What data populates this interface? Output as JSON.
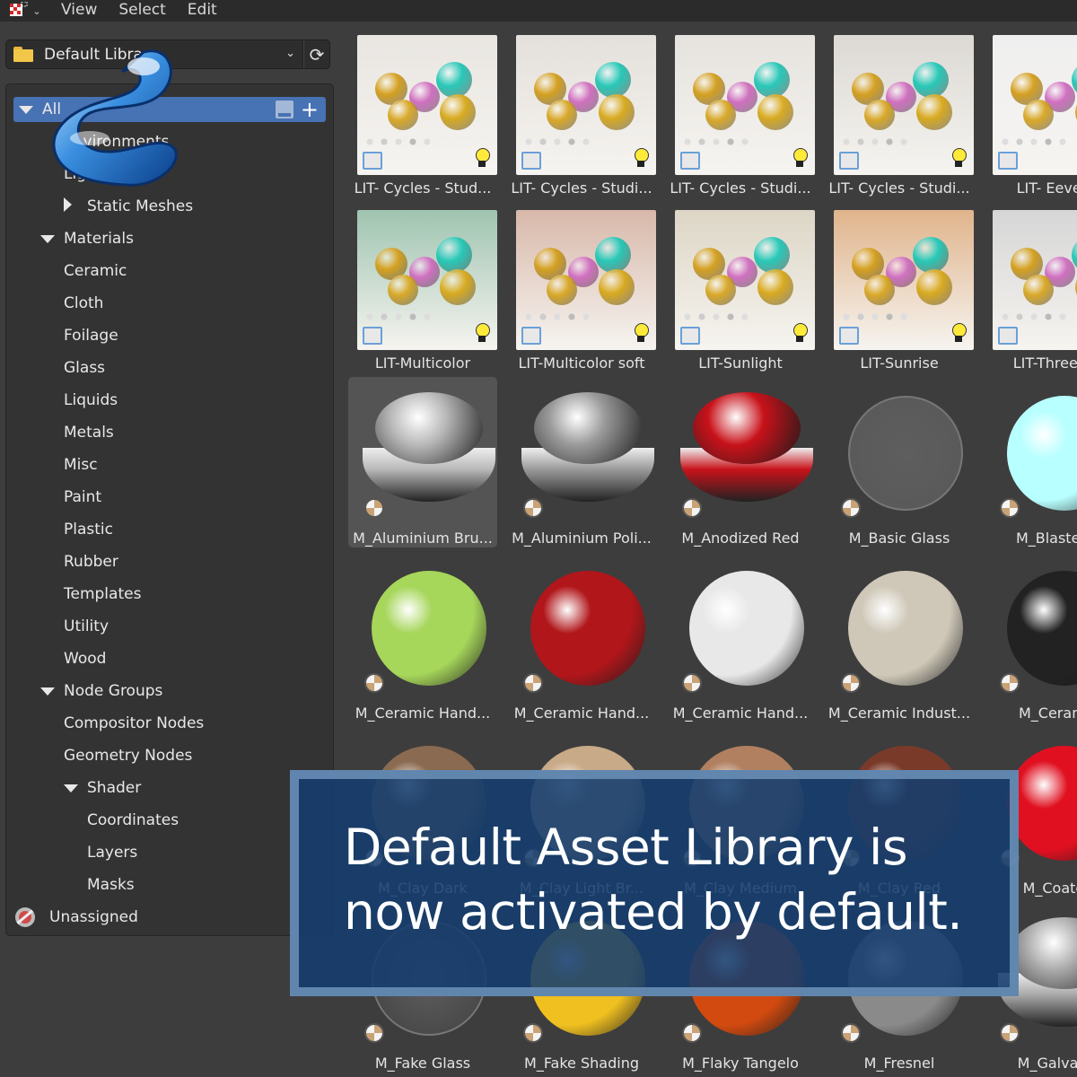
{
  "menubar": {
    "editor_type_icon": "asset-browser-icon",
    "items": [
      "View",
      "Select",
      "Edit"
    ]
  },
  "library": {
    "selected": "Default Library",
    "folder_icon": "folder-icon",
    "refresh_icon": "refresh-icon"
  },
  "catalog": {
    "items": [
      {
        "label": "All",
        "indent": 0,
        "expanded": true,
        "selected": true
      },
      {
        "label": "Environments",
        "indent": 1
      },
      {
        "label": "Lights",
        "indent": 1
      },
      {
        "label": "Static Meshes",
        "indent": 1,
        "collapsed": true
      },
      {
        "label": "Materials",
        "indent": 0,
        "expanded": true
      },
      {
        "label": "Ceramic",
        "indent": 1
      },
      {
        "label": "Cloth",
        "indent": 1
      },
      {
        "label": "Foilage",
        "indent": 1
      },
      {
        "label": "Glass",
        "indent": 1
      },
      {
        "label": "Liquids",
        "indent": 1
      },
      {
        "label": "Metals",
        "indent": 1
      },
      {
        "label": "Misc",
        "indent": 1
      },
      {
        "label": "Paint",
        "indent": 1
      },
      {
        "label": "Plastic",
        "indent": 1
      },
      {
        "label": "Rubber",
        "indent": 1
      },
      {
        "label": "Templates",
        "indent": 1
      },
      {
        "label": "Utility",
        "indent": 1
      },
      {
        "label": "Wood",
        "indent": 1
      },
      {
        "label": "Node Groups",
        "indent": 0,
        "expanded": true
      },
      {
        "label": "Compositor Nodes",
        "indent": 1
      },
      {
        "label": "Geometry Nodes",
        "indent": 1
      },
      {
        "label": "Shader",
        "indent": 1,
        "expanded": true
      },
      {
        "label": "Coordinates",
        "indent": 2
      },
      {
        "label": "Layers",
        "indent": 2
      },
      {
        "label": "Masks",
        "indent": 2
      }
    ],
    "unassigned": "Unassigned"
  },
  "assets": [
    {
      "label": "LIT- Cycles - Stud...",
      "kind": "scene",
      "bg": "#e9e6e2"
    },
    {
      "label": "LIT- Cycles - Studi...",
      "kind": "scene",
      "bg": "#e4e0dc"
    },
    {
      "label": "LIT- Cycles - Studi...",
      "kind": "scene",
      "bg": "#e6e3df"
    },
    {
      "label": "LIT- Cycles - Studi...",
      "kind": "scene",
      "bg": "#dcd9d4"
    },
    {
      "label": "LIT- Eevee - ",
      "kind": "scene",
      "bg": "#efefef"
    },
    {
      "label": "LIT-Multicolor",
      "kind": "scene",
      "bg": "#9fc4b0"
    },
    {
      "label": "LIT-Multicolor soft",
      "kind": "scene",
      "bg": "#d8b8aa"
    },
    {
      "label": "LIT-Sunlight",
      "kind": "scene",
      "bg": "#ddd6c6"
    },
    {
      "label": "LIT-Sunrise",
      "kind": "scene",
      "bg": "#e0b48c"
    },
    {
      "label": "LIT-Three Poi",
      "kind": "scene",
      "bg": "#d6d6d6"
    },
    {
      "label": "M_Aluminium Bru...",
      "kind": "shader",
      "color": "#b8b8b8"
    },
    {
      "label": "M_Aluminium Poli...",
      "kind": "shader",
      "color": "#9a9a9a"
    },
    {
      "label": "M_Anodized Red",
      "kind": "shader",
      "color": "#c8121a"
    },
    {
      "label": "M_Basic Glass",
      "kind": "glass",
      "color": "#5a5a5a"
    },
    {
      "label": "M_Blaster B",
      "kind": "sphere",
      "color": "#b8ffff"
    },
    {
      "label": "M_Ceramic Hand...",
      "kind": "sphere",
      "color": "#a6d65a"
    },
    {
      "label": "M_Ceramic Hand...",
      "kind": "sphere",
      "color": "#b0161a"
    },
    {
      "label": "M_Ceramic Hand...",
      "kind": "sphere",
      "color": "#e8e8e8"
    },
    {
      "label": "M_Ceramic Indust...",
      "kind": "sphere",
      "color": "#cfc8b8"
    },
    {
      "label": "M_Ceramic",
      "kind": "sphere",
      "color": "#222222"
    },
    {
      "label": "M_Clay Dark",
      "kind": "sphere",
      "color": "#8a6a50"
    },
    {
      "label": "M_Clay Light Br...",
      "kind": "sphere",
      "color": "#c8aa88"
    },
    {
      "label": "M_Clay Medium",
      "kind": "sphere",
      "color": "#b08060"
    },
    {
      "label": "M_Clay Red",
      "kind": "sphere",
      "color": "#7a3a2a"
    },
    {
      "label": "M_Coated",
      "kind": "sphere",
      "color": "#e01020"
    },
    {
      "label": "M_Fake Glass",
      "kind": "glass",
      "color": "#4a4a4a"
    },
    {
      "label": "M_Fake Shading",
      "kind": "sphere",
      "color": "#f0c020"
    },
    {
      "label": "M_Flaky Tangelo",
      "kind": "sphere",
      "color": "#d24a10"
    },
    {
      "label": "M_Fresnel",
      "kind": "sphere",
      "color": "#8a8a8a"
    },
    {
      "label": "M_Galvaniz",
      "kind": "shader",
      "color": "#aaaaaa"
    }
  ],
  "overlay": {
    "text": "Default Asset Library is now activated by default."
  },
  "colors": {
    "selection": "#4772b3",
    "overlay_bg": "#143e6e",
    "overlay_border": "#678cb4"
  }
}
